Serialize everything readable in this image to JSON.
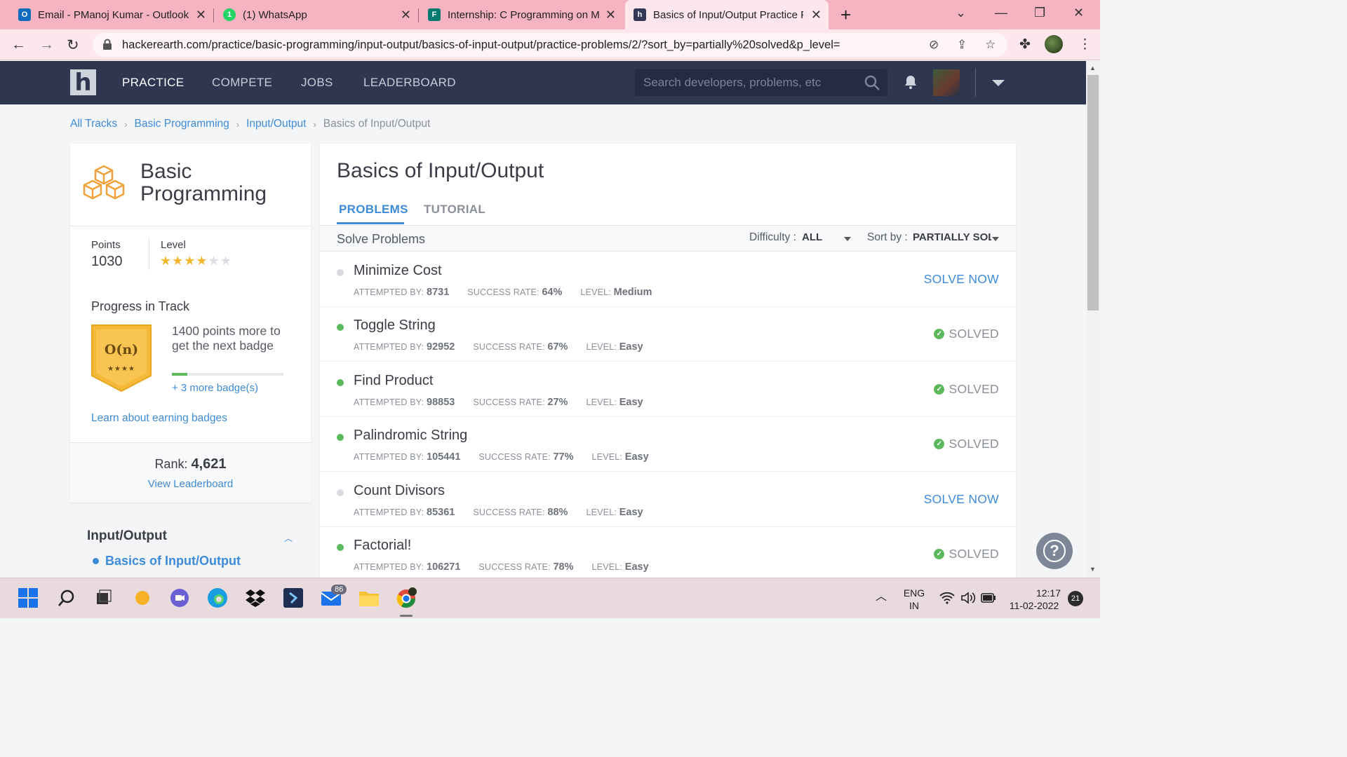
{
  "browser": {
    "tabs": [
      {
        "title": "Email - PManoj Kumar - Outlook",
        "icon": "outlook-icon"
      },
      {
        "title": "(1) WhatsApp",
        "icon": "whatsapp-icon"
      },
      {
        "title": "Internship: C Programming on M",
        "icon": "forms-icon"
      },
      {
        "title": "Basics of Input/Output Practice P",
        "icon": "hackerearth-icon"
      }
    ],
    "url": "hackerearth.com/practice/basic-programming/input-output/basics-of-input-output/practice-problems/2/?sort_by=partially%20solved&p_level="
  },
  "header": {
    "logo": "h",
    "nav": [
      "PRACTICE",
      "COMPETE",
      "JOBS",
      "LEADERBOARD"
    ],
    "search_placeholder": "Search developers, problems, etc"
  },
  "breadcrumb": [
    "All Tracks",
    "Basic Programming",
    "Input/Output",
    "Basics of Input/Output"
  ],
  "track": {
    "title_line1": "Basic",
    "title_line2": "Programming",
    "points_label": "Points",
    "points": "1030",
    "level_label": "Level",
    "level_stars": 4,
    "level_stars_max": 6,
    "progress_title": "Progress in Track",
    "badge_label": "O(n)",
    "badge_stars": "★★★★",
    "next_badge_text": "1400 points more to get the next badge",
    "progress_fraction": 0.14,
    "more_badges": "+ 3 more badge(s)",
    "learn_link": "Learn about earning badges",
    "rank_label": "Rank:",
    "rank": "4,621",
    "leaderboard_link": "View Leaderboard"
  },
  "sidebar_section": {
    "heading": "Input/Output",
    "item": "Basics of Input/Output"
  },
  "main": {
    "title": "Basics of Input/Output",
    "tabs": [
      "PROBLEMS",
      "TUTORIAL"
    ],
    "solve_label": "Solve Problems",
    "difficulty_label": "Difficulty :",
    "difficulty_value": "ALL",
    "sort_label": "Sort by :",
    "sort_value": "PARTIALLY SOLVED",
    "meta_labels": {
      "attempted": "ATTEMPTED BY:",
      "success": "SUCCESS RATE:",
      "level": "LEVEL:"
    },
    "problems": [
      {
        "name": "Minimize Cost",
        "attempted": "8731",
        "success": "64%",
        "level": "Medium",
        "status": "SOLVE NOW",
        "solved": false
      },
      {
        "name": "Toggle String",
        "attempted": "92952",
        "success": "67%",
        "level": "Easy",
        "status": "SOLVED",
        "solved": true
      },
      {
        "name": "Find Product",
        "attempted": "98853",
        "success": "27%",
        "level": "Easy",
        "status": "SOLVED",
        "solved": true
      },
      {
        "name": "Palindromic String",
        "attempted": "105441",
        "success": "77%",
        "level": "Easy",
        "status": "SOLVED",
        "solved": true
      },
      {
        "name": "Count Divisors",
        "attempted": "85361",
        "success": "88%",
        "level": "Easy",
        "status": "SOLVE NOW",
        "solved": false
      },
      {
        "name": "Factorial!",
        "attempted": "106271",
        "success": "78%",
        "level": "Easy",
        "status": "SOLVED",
        "solved": true
      }
    ]
  },
  "taskbar": {
    "mail_badge": "86",
    "lang_line1": "ENG",
    "lang_line2": "IN",
    "time": "12:17",
    "date": "11-02-2022",
    "notifications": "21"
  },
  "colors": {
    "accent": "#3d8bd8",
    "header_bg": "#2e3650",
    "solved_green": "#5cb85c",
    "star": "#f3b72e",
    "badge": "#f5b939"
  }
}
